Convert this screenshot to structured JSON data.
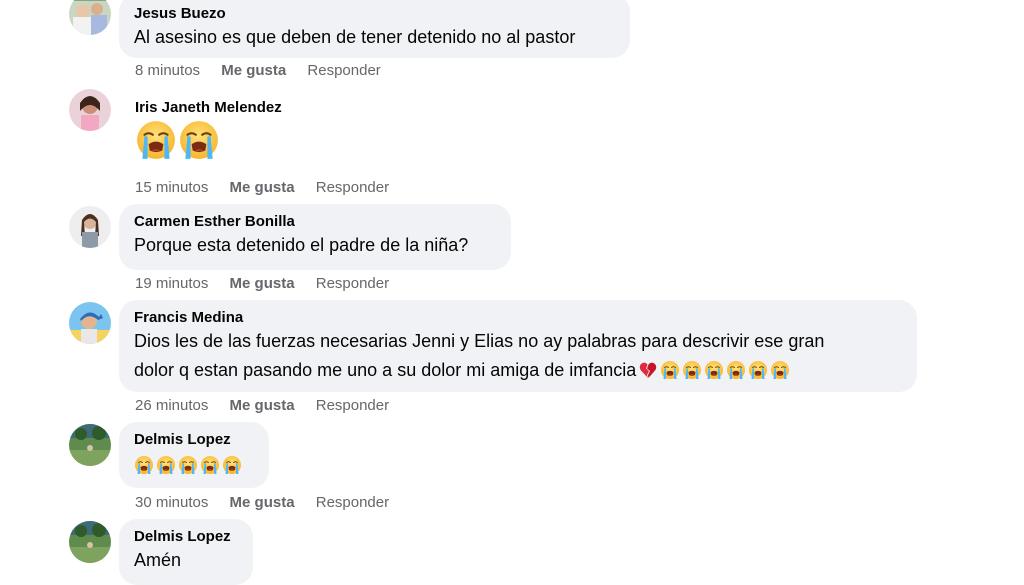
{
  "comments": [
    {
      "author": "Jesus Buezo",
      "text": "Al asesino es que deben de tener detenido no al pastor",
      "time": "8 minutos",
      "like_label": "Me gusta",
      "reply_label": "Responder"
    },
    {
      "author": "Iris Janeth Melendez",
      "emojis": "😭😭",
      "time": "15 minutos",
      "like_label": "Me gusta",
      "reply_label": "Responder"
    },
    {
      "author": "Carmen Esther Bonilla",
      "text": "Porque esta detenido el padre de la niña?",
      "time": "19 minutos",
      "like_label": "Me gusta",
      "reply_label": "Responder"
    },
    {
      "author": "Francis Medina",
      "text_line1": "Dios les de las fuerzas necesarias Jenni y Elias no ay palabras para descrivir ese gran",
      "text_line2": "dolor q estan pasando me uno a su dolor mi amiga de imfancia",
      "emojis": "💔😭😭😭😭😭😭",
      "time": "26 minutos",
      "like_label": "Me gusta",
      "reply_label": "Responder"
    },
    {
      "author": "Delmis Lopez",
      "emojis": "😭😭😭😭😭",
      "time": "30 minutos",
      "like_label": "Me gusta",
      "reply_label": "Responder"
    },
    {
      "author": "Delmis Lopez",
      "text": "Amén"
    }
  ],
  "colors": {
    "bubble": "#f0f2f5",
    "meta": "#65676b",
    "text": "#050505"
  },
  "icons": {
    "crying_face": "loudly-crying-face-icon",
    "broken_heart": "broken-heart-icon"
  }
}
